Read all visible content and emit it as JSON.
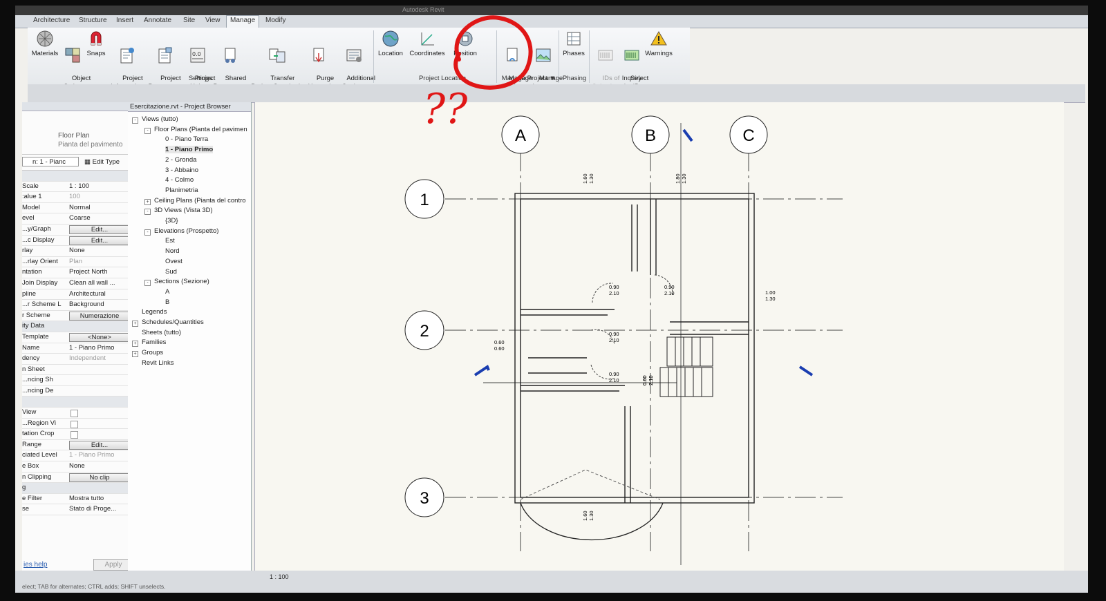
{
  "tabs": [
    "Architecture",
    "Structure",
    "Insert",
    "Annotate",
    "Site",
    "View",
    "Manage",
    "Modify"
  ],
  "ribbon": {
    "buttons": [
      {
        "label": "Materials"
      },
      {
        "label": "Object\nStyles"
      },
      {
        "label": "Snaps"
      },
      {
        "label": "Project\nInformation"
      },
      {
        "label": "Project\nParameters"
      },
      {
        "label": "Project\nUnits"
      },
      {
        "label": "Shared\nParameters"
      },
      {
        "label": "Transfer\nProject Standards"
      },
      {
        "label": "Purge\nUnused"
      },
      {
        "label": "Additional\nSettings"
      },
      {
        "label": "Location"
      },
      {
        "label": "Coordinates"
      },
      {
        "label": "Position"
      },
      {
        "label": "Manage\nLinks"
      },
      {
        "label": "Manage\nImages"
      },
      {
        "label": "Phases"
      },
      {
        "label": "IDs of\nSelection"
      },
      {
        "label": "Select\nby ID"
      },
      {
        "label": "Warnings"
      }
    ],
    "groups": [
      "Settings",
      "Project Location",
      "Manage Project",
      "Phasing",
      "Inquiry"
    ]
  },
  "annotation": {
    "text": "??",
    "color": "#e01616"
  },
  "properties": {
    "type_line1": "Floor Plan",
    "type_line2": "Pianta del pavimento",
    "selector": "n: 1 - Pianc",
    "edit_type": "Edit Type",
    "rows": [
      {
        "k": "",
        "v": "",
        "cat": true
      },
      {
        "k": "Scale",
        "v": "1 : 100"
      },
      {
        "k": "alue   1:",
        "v": "100",
        "dim": true
      },
      {
        "k": "Model",
        "v": "Normal"
      },
      {
        "k": "evel",
        "v": "Coarse"
      },
      {
        "k": "y/Graph...",
        "v": "Edit...",
        "btn": true
      },
      {
        "k": "c Display...",
        "v": "Edit...",
        "btn": true
      },
      {
        "k": "rlay",
        "v": "None"
      },
      {
        "k": "rlay Orient...",
        "v": "Plan",
        "dim": true
      },
      {
        "k": "ntation",
        "v": "Project North"
      },
      {
        "k": "Join Display",
        "v": "Clean all wall ..."
      },
      {
        "k": "pline",
        "v": "Architectural"
      },
      {
        "k": "r Scheme L...",
        "v": "Background"
      },
      {
        "k": "r Scheme",
        "v": "Numerazione",
        "btn": true
      },
      {
        "k": "ity Data",
        "v": "",
        "cat": true
      },
      {
        "k": "Template",
        "v": "<None>",
        "btn": true
      },
      {
        "k": "Name",
        "v": "1 - Piano Primo"
      },
      {
        "k": "dency",
        "v": "Independent",
        "dim": true
      },
      {
        "k": "n Sheet",
        "v": ""
      },
      {
        "k": "ncing Sh...",
        "v": ""
      },
      {
        "k": "ncing De...",
        "v": ""
      },
      {
        "k": "",
        "v": "",
        "cat": true
      },
      {
        "k": "View",
        "v": "",
        "chk": true
      },
      {
        "k": "Region Vi...",
        "v": "",
        "chk": true
      },
      {
        "k": "tation Crop",
        "v": "",
        "chk": true
      },
      {
        "k": "Range",
        "v": "Edit...",
        "btn": true
      },
      {
        "k": "ciated Level",
        "v": "1 - Piano Primo",
        "dim": true
      },
      {
        "k": "e Box",
        "v": "None"
      },
      {
        "k": "n Clipping",
        "v": "No clip",
        "btn": true
      },
      {
        "k": "g",
        "v": "",
        "cat": true
      },
      {
        "k": "e Filter",
        "v": "Mostra tutto"
      },
      {
        "k": "se",
        "v": "Stato di Proge..."
      }
    ],
    "help": "ies help",
    "apply": "Apply"
  },
  "browser": {
    "title": "Esercitazione.rvt - Project Browser",
    "nodes": [
      {
        "t": "Views (tutto)",
        "d": 1,
        "pm": "-"
      },
      {
        "t": "Floor Plans (Pianta del pavimen",
        "d": 2,
        "pm": "-"
      },
      {
        "t": "0 - Piano Terra",
        "d": 3
      },
      {
        "t": "1 - Piano Primo",
        "d": 3,
        "bold": true
      },
      {
        "t": "2 - Gronda",
        "d": 3
      },
      {
        "t": "3 - Abbaino",
        "d": 3
      },
      {
        "t": "4 - Colmo",
        "d": 3
      },
      {
        "t": "Planimetria",
        "d": 3
      },
      {
        "t": "Ceiling Plans (Pianta del contro",
        "d": 2,
        "pm": "+"
      },
      {
        "t": "3D Views (Vista 3D)",
        "d": 2,
        "pm": "-"
      },
      {
        "t": "{3D}",
        "d": 3
      },
      {
        "t": "Elevations (Prospetto)",
        "d": 2,
        "pm": "-"
      },
      {
        "t": "Est",
        "d": 3
      },
      {
        "t": "Nord",
        "d": 3
      },
      {
        "t": "Ovest",
        "d": 3
      },
      {
        "t": "Sud",
        "d": 3
      },
      {
        "t": "Sections (Sezione)",
        "d": 2,
        "pm": "-"
      },
      {
        "t": "A",
        "d": 3
      },
      {
        "t": "B",
        "d": 3
      },
      {
        "t": "Legends",
        "d": 1
      },
      {
        "t": "Schedules/Quantities",
        "d": 1,
        "pm": "+"
      },
      {
        "t": "Sheets (tutto)",
        "d": 1
      },
      {
        "t": "Families",
        "d": 1,
        "pm": "+"
      },
      {
        "t": "Groups",
        "d": 1,
        "pm": "+"
      },
      {
        "t": "Revit Links",
        "d": 1
      }
    ]
  },
  "plan": {
    "grid_cols": [
      "A",
      "B",
      "C"
    ],
    "grid_rows": [
      "1",
      "2",
      "3"
    ],
    "dims": [
      {
        "a": "1.60",
        "b": "1.30"
      },
      {
        "a": "1.80",
        "b": "1.30"
      },
      {
        "a": "1.00",
        "b": "1.30"
      },
      {
        "a": "0.60",
        "b": "0.60"
      },
      {
        "a": "0.90",
        "b": "2.10"
      },
      {
        "a": "0.90",
        "b": "2.10"
      },
      {
        "a": "0.90",
        "b": "2.10"
      },
      {
        "a": "0.90",
        "b": "2.10"
      },
      {
        "a": "0.60",
        "b": "2.10"
      },
      {
        "a": "0.60",
        "b": "2.10"
      },
      {
        "a": "1.60",
        "b": "1.30"
      }
    ]
  },
  "status": {
    "scale": "1 : 100",
    "hint": "elect; TAB for alternates; CTRL adds; SHIFT unselects."
  }
}
